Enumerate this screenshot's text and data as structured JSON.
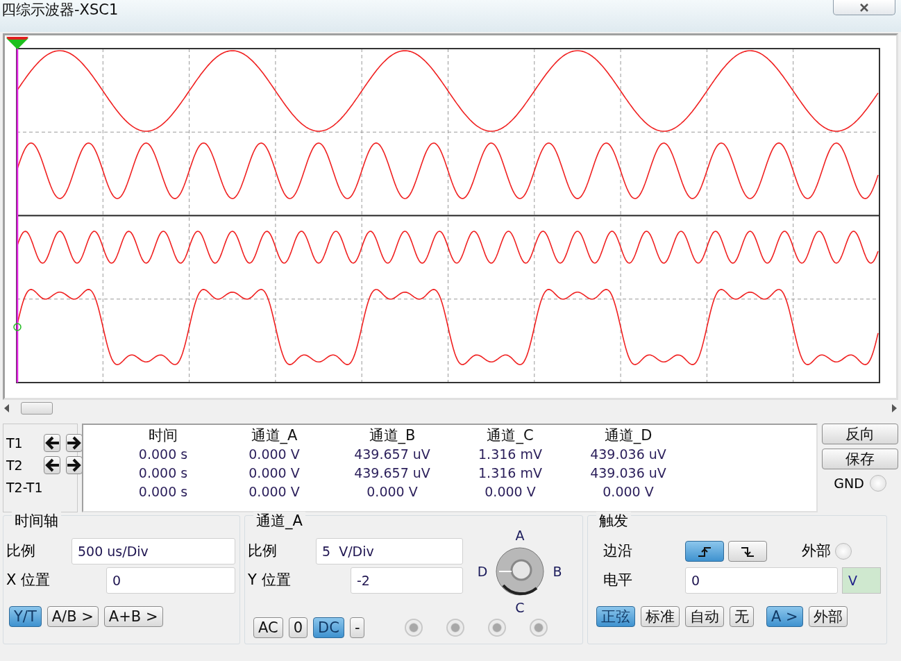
{
  "window": {
    "title": "四综示波器-XSC1"
  },
  "readout": {
    "row_labels": [
      "T1",
      "T2",
      "T2-T1"
    ],
    "columns": [
      "时间",
      "通道_A",
      "通道_B",
      "通道_C",
      "通道_D"
    ],
    "rows": [
      [
        "0.000 s",
        "0.000 V",
        "439.657 uV",
        "1.316 mV",
        "439.036 uV"
      ],
      [
        "0.000 s",
        "0.000 V",
        "439.657 uV",
        "1.316 mV",
        "439.036 uV"
      ],
      [
        "0.000 s",
        "0.000 V",
        "0.000 V",
        "0.000 V",
        "0.000 V"
      ]
    ],
    "side_buttons": [
      "反向",
      "保存"
    ],
    "gnd": {
      "label": "GND",
      "selected": false
    }
  },
  "timebase": {
    "title": "时间轴",
    "scale_label": "比例",
    "scale": "500 us/Div",
    "xpos_label": "X 位置",
    "xpos": "0",
    "modes": [
      {
        "label": "Y/T",
        "selected": true
      },
      {
        "label": "A/B >",
        "selected": false
      },
      {
        "label": "A+B >",
        "selected": false
      }
    ]
  },
  "channel": {
    "title": "通道_A",
    "scale_label": "比例",
    "scale": "5  V/Div",
    "ypos_label": "Y 位置",
    "ypos": "-2",
    "coupling": [
      {
        "label": "AC",
        "selected": false
      },
      {
        "label": "0",
        "selected": false
      },
      {
        "label": "DC",
        "selected": true
      },
      {
        "label": "-",
        "selected": false
      }
    ],
    "knob_labels": [
      "A",
      "B",
      "C",
      "D"
    ]
  },
  "trigger": {
    "title": "触发",
    "edge_label": "边沿",
    "edges": [
      {
        "kind": "rising",
        "selected": true
      },
      {
        "kind": "falling",
        "selected": false
      }
    ],
    "external": {
      "label": "外部",
      "selected": false
    },
    "level_label": "电平",
    "level": "0",
    "unit": "V",
    "types": [
      {
        "label": "正弦",
        "selected": true
      },
      {
        "label": "标准",
        "selected": false
      },
      {
        "label": "自动",
        "selected": false
      },
      {
        "label": "无",
        "selected": false
      }
    ],
    "sources": [
      {
        "label": "A >",
        "selected": true
      },
      {
        "label": "外部",
        "selected": false
      }
    ]
  }
}
